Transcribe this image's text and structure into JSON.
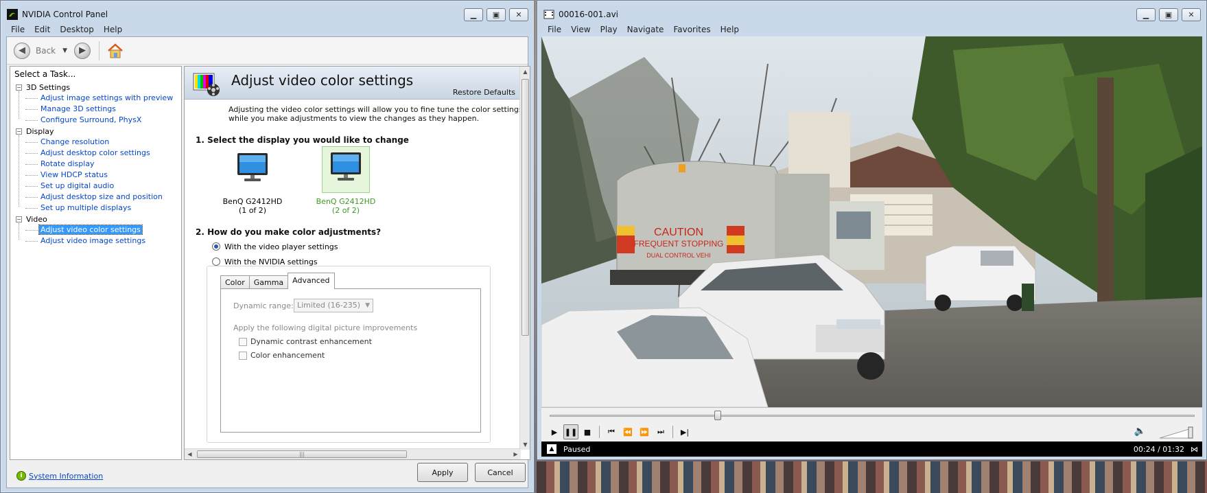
{
  "nvidia": {
    "title": "NVIDIA Control Panel",
    "menu": [
      "File",
      "Edit",
      "Desktop",
      "Help"
    ],
    "toolbar": {
      "back_label": "Back"
    },
    "task_heading": "Select a Task...",
    "tree": [
      {
        "label": "3D Settings",
        "items": [
          "Adjust image settings with preview",
          "Manage 3D settings",
          "Configure Surround, PhysX"
        ]
      },
      {
        "label": "Display",
        "items": [
          "Change resolution",
          "Adjust desktop color settings",
          "Rotate display",
          "View HDCP status",
          "Set up digital audio",
          "Adjust desktop size and position",
          "Set up multiple displays"
        ]
      },
      {
        "label": "Video",
        "items": [
          "Adjust video color settings",
          "Adjust video image settings"
        ]
      }
    ],
    "selected_item": "Adjust video color settings",
    "system_info": "System Information",
    "page_title": "Adjust video color settings",
    "restore_defaults": "Restore Defaults",
    "intro_line1": "Adjusting the video color settings will allow you to fine tune the color settings for video cont",
    "intro_line2": "while you make adjustments to view the changes as they happen.",
    "section1": "1. Select the display you would like to change",
    "displays": [
      {
        "name": "BenQ G2412HD",
        "index": "(1 of 2)"
      },
      {
        "name": "BenQ G2412HD",
        "index": "(2 of 2)"
      }
    ],
    "section2": "2. How do you make color adjustments?",
    "radio_video_player": "With the video player settings",
    "radio_nvidia": "With the NVIDIA settings",
    "tabs": [
      "Color",
      "Gamma",
      "Advanced"
    ],
    "dynamic_range_label": "Dynamic range:",
    "dynamic_range_value": "Limited (16-235)",
    "apply_improvements": "Apply the following digital picture improvements",
    "chk_dynamic_contrast": "Dynamic contrast enhancement",
    "chk_color": "Color enhancement",
    "apply_button": "Apply",
    "cancel_button": "Cancel"
  },
  "player": {
    "title": "00016-001.avi",
    "menu": [
      "File",
      "View",
      "Play",
      "Navigate",
      "Favorites",
      "Help"
    ],
    "status": "Paused",
    "time": "00:24 / 01:32",
    "progress": 0.26,
    "video_text": {
      "caution": "CAUTION",
      "frequent": "FREQUENT STOPPING",
      "dual": "DUAL CONTROL VEHI"
    }
  },
  "colors": {
    "nvidia_green": "#76b900",
    "link_blue": "#0646c8",
    "selection": "#3399ff",
    "window_frame": "#c9d9ea"
  }
}
